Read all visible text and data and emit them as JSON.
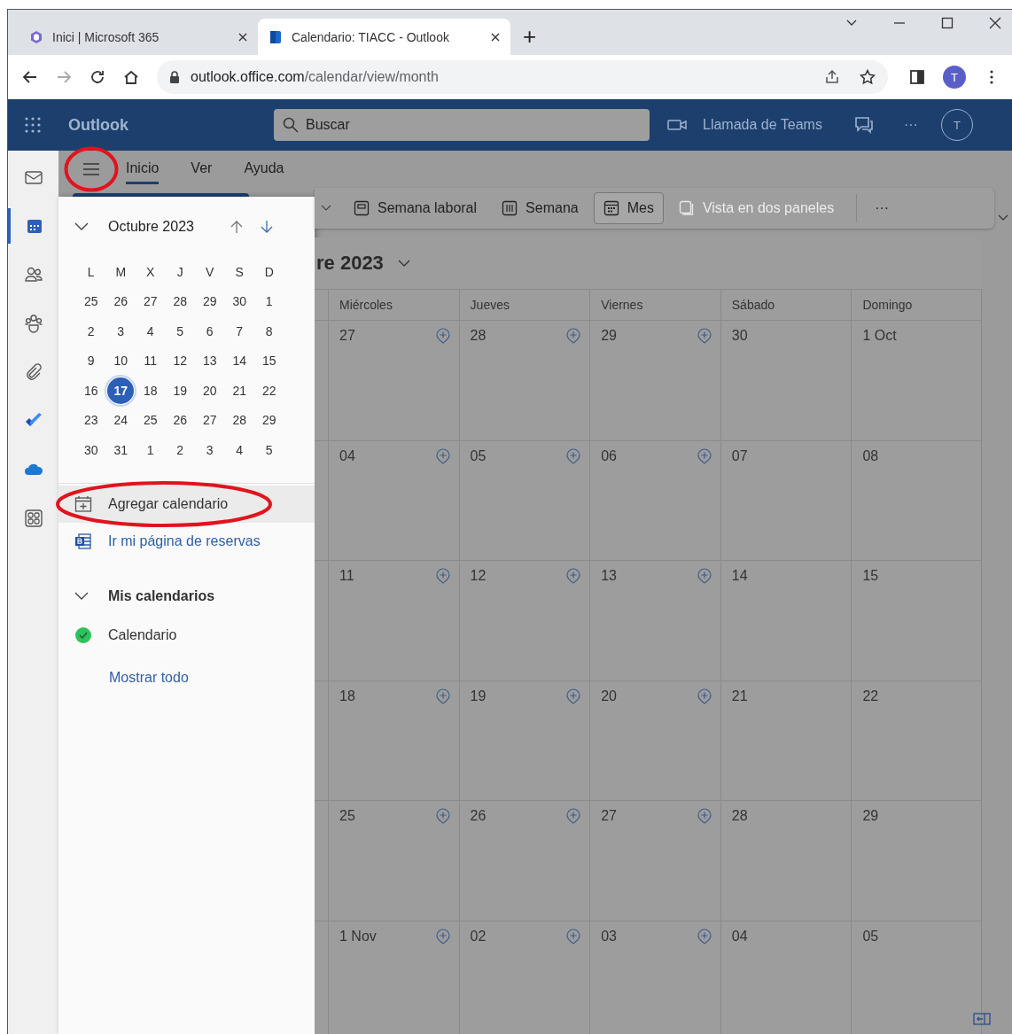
{
  "browser": {
    "tabs": [
      {
        "title": "Inici | Microsoft 365",
        "selected": false,
        "kind": "m365"
      },
      {
        "title": "Calendario: TIACC - Outlook",
        "selected": true,
        "kind": "outlook"
      }
    ],
    "new_tab": "+",
    "url_host": "outlook.office.com",
    "url_path": "/calendar/view/month",
    "profile": "T"
  },
  "app_header": {
    "title": "Outlook",
    "search": {
      "placeholder": "Buscar"
    },
    "teams_call": "Llamada de Teams",
    "more": "···",
    "avatar": "T"
  },
  "rail": [
    {
      "kind": "mail",
      "selected": false
    },
    {
      "kind": "calendar",
      "selected": true
    },
    {
      "kind": "people",
      "selected": false
    },
    {
      "kind": "groups",
      "selected": false
    },
    {
      "kind": "files",
      "selected": false
    },
    {
      "kind": "todo",
      "selected": false
    },
    {
      "kind": "cloud",
      "selected": false
    },
    {
      "kind": "apps",
      "selected": false
    }
  ],
  "menu_button": {
    "circled": true
  },
  "nav_tabs": [
    {
      "label": "Inicio",
      "selected": true
    },
    {
      "label": "Ver",
      "selected": false
    },
    {
      "label": "Ayuda",
      "selected": false
    }
  ],
  "ribbon": [
    {
      "label": "Semana laboral",
      "kind": "workweek",
      "selected": false,
      "disabled": false
    },
    {
      "label": "Semana",
      "kind": "week",
      "selected": false,
      "disabled": false
    },
    {
      "label": "Mes",
      "kind": "month",
      "selected": true,
      "disabled": false
    },
    {
      "label": "Vista en dos paneles",
      "kind": "split",
      "selected": false,
      "disabled": true
    }
  ],
  "ribbon_more": "···",
  "mini_calendar": {
    "title": "Octubre 2023",
    "weekdays": [
      "L",
      "M",
      "X",
      "J",
      "V",
      "S",
      "D"
    ],
    "weeks": [
      [
        {
          "d": "25",
          "selected": false
        },
        {
          "d": "26",
          "selected": false
        },
        {
          "d": "27",
          "selected": false
        },
        {
          "d": "28",
          "selected": false
        },
        {
          "d": "29",
          "selected": false
        },
        {
          "d": "30",
          "selected": false
        },
        {
          "d": "1",
          "selected": false
        }
      ],
      [
        {
          "d": "2",
          "selected": false
        },
        {
          "d": "3",
          "selected": false
        },
        {
          "d": "4",
          "selected": false
        },
        {
          "d": "5",
          "selected": false
        },
        {
          "d": "6",
          "selected": false
        },
        {
          "d": "7",
          "selected": false
        },
        {
          "d": "8",
          "selected": false
        }
      ],
      [
        {
          "d": "9",
          "selected": false
        },
        {
          "d": "10",
          "selected": false
        },
        {
          "d": "11",
          "selected": false
        },
        {
          "d": "12",
          "selected": false
        },
        {
          "d": "13",
          "selected": false
        },
        {
          "d": "14",
          "selected": false
        },
        {
          "d": "15",
          "selected": false
        }
      ],
      [
        {
          "d": "16",
          "selected": false
        },
        {
          "d": "17",
          "selected": true
        },
        {
          "d": "18",
          "selected": false
        },
        {
          "d": "19",
          "selected": false
        },
        {
          "d": "20",
          "selected": false
        },
        {
          "d": "21",
          "selected": false
        },
        {
          "d": "22",
          "selected": false
        }
      ],
      [
        {
          "d": "23",
          "selected": false
        },
        {
          "d": "24",
          "selected": false
        },
        {
          "d": "25",
          "selected": false
        },
        {
          "d": "26",
          "selected": false
        },
        {
          "d": "27",
          "selected": false
        },
        {
          "d": "28",
          "selected": false
        },
        {
          "d": "29",
          "selected": false
        }
      ],
      [
        {
          "d": "30",
          "selected": false
        },
        {
          "d": "31",
          "selected": false
        },
        {
          "d": "1",
          "selected": false
        },
        {
          "d": "2",
          "selected": false
        },
        {
          "d": "3",
          "selected": false
        },
        {
          "d": "4",
          "selected": false
        },
        {
          "d": "5",
          "selected": false
        }
      ]
    ]
  },
  "panel_actions": [
    {
      "label": "Agregar calendario",
      "kind": "add",
      "circled": true
    },
    {
      "label": "Ir mi página de reservas",
      "kind": "booking",
      "circled": false
    }
  ],
  "my_calendars": {
    "title": "Mis calendarios",
    "items": [
      {
        "name": "Calendario",
        "color": "#2fc15b",
        "checked": true
      }
    ],
    "show_all": "Mostrar todo"
  },
  "month_view": {
    "title": "re 2023",
    "columns": [
      "Miércoles",
      "Jueves",
      "Viernes",
      "Sábado",
      "Domingo"
    ],
    "weeks": [
      [
        {
          "label": "27",
          "add": true
        },
        {
          "label": "28",
          "add": true
        },
        {
          "label": "29",
          "add": true
        },
        {
          "label": "30",
          "add": false
        },
        {
          "label": "1 Oct",
          "add": false
        }
      ],
      [
        {
          "label": "04",
          "add": true
        },
        {
          "label": "05",
          "add": true
        },
        {
          "label": "06",
          "add": true
        },
        {
          "label": "07",
          "add": false
        },
        {
          "label": "08",
          "add": false
        }
      ],
      [
        {
          "label": "11",
          "add": true
        },
        {
          "label": "12",
          "add": true
        },
        {
          "label": "13",
          "add": true
        },
        {
          "label": "14",
          "add": false
        },
        {
          "label": "15",
          "add": false
        }
      ],
      [
        {
          "label": "18",
          "add": true
        },
        {
          "label": "19",
          "add": true
        },
        {
          "label": "20",
          "add": true
        },
        {
          "label": "21",
          "add": false
        },
        {
          "label": "22",
          "add": false
        }
      ],
      [
        {
          "label": "25",
          "add": true
        },
        {
          "label": "26",
          "add": true
        },
        {
          "label": "27",
          "add": true
        },
        {
          "label": "28",
          "add": false
        },
        {
          "label": "29",
          "add": false
        }
      ],
      [
        {
          "label": "1 Nov",
          "add": true
        },
        {
          "label": "02",
          "add": true
        },
        {
          "label": "03",
          "add": true
        },
        {
          "label": "04",
          "add": false
        },
        {
          "label": "05",
          "add": false
        }
      ]
    ]
  }
}
